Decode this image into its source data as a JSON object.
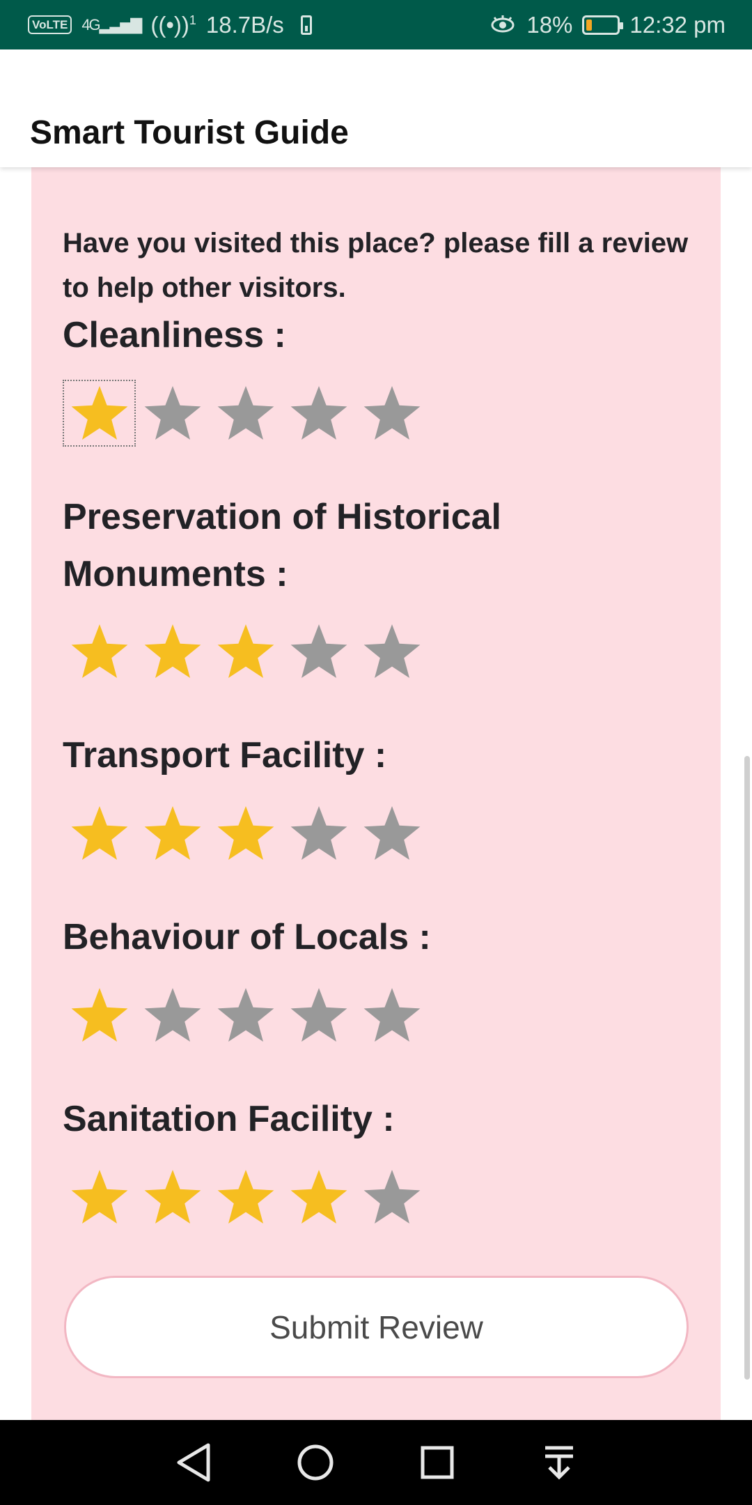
{
  "status_bar": {
    "network": "VoLTE",
    "signal": "4G",
    "hotspot_count": "1",
    "speed": "18.7B/s",
    "battery_percent": "18%",
    "time": "12:32 pm",
    "battery_level": 0.18
  },
  "app_bar": {
    "title": "Smart Tourist Guide"
  },
  "review": {
    "intro": "Have you visited this place? please fill a review to help other visitors.",
    "colors": {
      "star_filled": "#F6BE20",
      "star_empty": "#999999",
      "background": "#FDDDE2"
    },
    "categories": [
      {
        "label": "Cleanliness :",
        "rating": 1,
        "max": 5
      },
      {
        "label": "Preservation of Historical Monuments :",
        "rating": 3,
        "max": 5
      },
      {
        "label": "Transport Facility :",
        "rating": 3,
        "max": 5
      },
      {
        "label": "Behaviour of Locals :",
        "rating": 1,
        "max": 5
      },
      {
        "label": "Sanitation Facility :",
        "rating": 4,
        "max": 5
      }
    ],
    "submit_label": "Submit Review"
  },
  "nav_bar": {
    "buttons": [
      "back-icon",
      "home-icon",
      "recents-icon",
      "notifications-pull-icon"
    ]
  }
}
